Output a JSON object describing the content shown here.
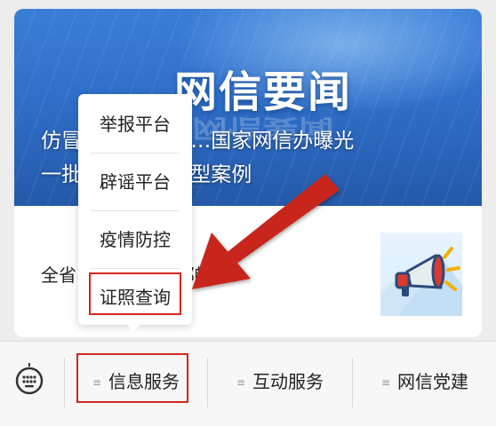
{
  "banner": {
    "title": "网信要闻",
    "title_reflection": "网信要闻",
    "caption_line1": "仿冒… …充民警…国家网信办曝光",
    "caption_line2": "一批… …诈骗典型案例"
  },
  "article": {
    "title": "全省… …点… …都畅通！",
    "thumbnail_icon": "megaphone-icon"
  },
  "popup_menu": {
    "items": [
      {
        "label": "举报平台"
      },
      {
        "label": "辟谣平台"
      },
      {
        "label": "疫情防控"
      },
      {
        "label": "证照查询"
      }
    ]
  },
  "bottom_bar": {
    "keyboard_icon": "keyboard-icon",
    "tabs": [
      {
        "label": "信息服务"
      },
      {
        "label": "互动服务"
      },
      {
        "label": "网信党建"
      }
    ]
  },
  "annotations": {
    "highlight_color": "#d4261c",
    "arrow_color": "#c8281c"
  }
}
